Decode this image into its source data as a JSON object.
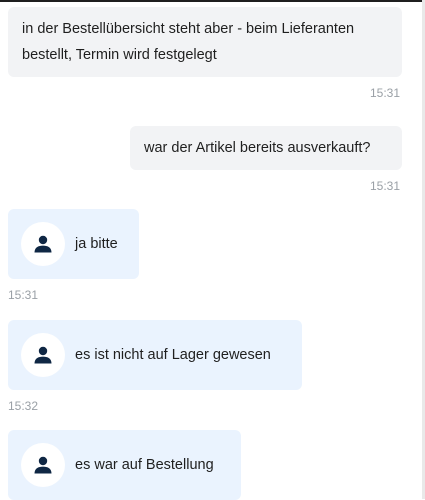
{
  "chat": {
    "messages": [
      {
        "sender": "user",
        "text": "in der Bestellübersicht steht aber - beim Lieferanten bestellt, Termin wird festgelegt",
        "time": "15:31"
      },
      {
        "sender": "user",
        "text": "war der Artikel bereits ausverkauft?",
        "time": "15:31"
      },
      {
        "sender": "agent",
        "text": "ja bitte",
        "time": "15:31",
        "icon": "person-icon"
      },
      {
        "sender": "agent",
        "text": "es ist nicht auf Lager gewesen",
        "time": "15:32",
        "icon": "person-icon"
      },
      {
        "sender": "agent",
        "text": "es war auf Bestellung",
        "icon": "person-icon"
      }
    ]
  },
  "colors": {
    "user_bubble": "#f2f3f5",
    "agent_bubble": "#eaf3fe",
    "icon": "#0f2744",
    "timestamp": "#9aa0a6"
  }
}
